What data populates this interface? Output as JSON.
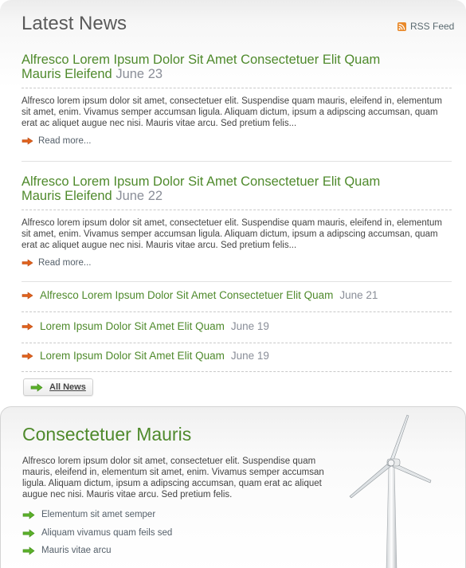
{
  "panel": {
    "title": "Latest News",
    "rss_label": "RSS Feed"
  },
  "featured": [
    {
      "title": "Alfresco Lorem Ipsum Dolor Sit Amet Consectetuer Elit Quam Mauris Eleifend",
      "date": "June 23",
      "excerpt": "Alfresco lorem ipsum dolor sit amet, consectetuer elit. Suspendise quam mauris, eleifend in, elementum sit amet, enim. Vivamus semper accumsan ligula. Aliquam dictum, ipsum a adipscing accumsan, quam erat ac aliquet augue nec nisi. Mauris vitae arcu. Sed pretium felis...",
      "read_more": "Read more..."
    },
    {
      "title": "Alfresco Lorem Ipsum Dolor Sit Amet Consectetuer Elit Quam Mauris Eleifend",
      "date": "June 22",
      "excerpt": "Alfresco lorem ipsum dolor sit amet, consectetuer elit. Suspendise quam mauris, eleifend in, elementum sit amet, enim. Vivamus semper accumsan ligula. Aliquam dictum, ipsum a adipscing accumsan, quam erat ac aliquet augue nec nisi. Mauris vitae arcu. Sed pretium felis...",
      "read_more": "Read more..."
    }
  ],
  "headlines": [
    {
      "title": "Alfresco Lorem Ipsum Dolor Sit Amet Consectetuer Elit Quam",
      "date": "June 21"
    },
    {
      "title": "Lorem Ipsum Dolor Sit Amet Elit Quam",
      "date": "June 19"
    },
    {
      "title": "Lorem Ipsum Dolor Sit Amet Elit Quam",
      "date": "June 19"
    }
  ],
  "all_news_label": "All News",
  "feature": {
    "title": "Consectetuer Mauris",
    "body": "Alfresco lorem ipsum dolor sit amet, consectetuer elit. Suspendise quam mauris, eleifend in, elementum sit amet, enim. Vivamus semper accumsan ligula. Aliquam dictum, ipsum a adipscing accumsan, quam erat ac aliquet augue nec nisi. Mauris vitae arcu. Sed pretium felis.",
    "links": [
      "Elementum sit amet semper",
      "Aliquam vivamus quam feils sed",
      "Mauris vitae arcu"
    ],
    "image": "wind-turbine"
  },
  "colors": {
    "title_green": "#4f8a2c",
    "date_gray": "#8a8e98",
    "arrow_orange": "#e0621c",
    "arrow_green": "#5bb02a",
    "rss_orange": "#e9892a"
  },
  "icons": {
    "bullet_news": "orange-arrow-icon",
    "bullet_feature": "green-arrow-icon",
    "rss": "rss-icon"
  }
}
